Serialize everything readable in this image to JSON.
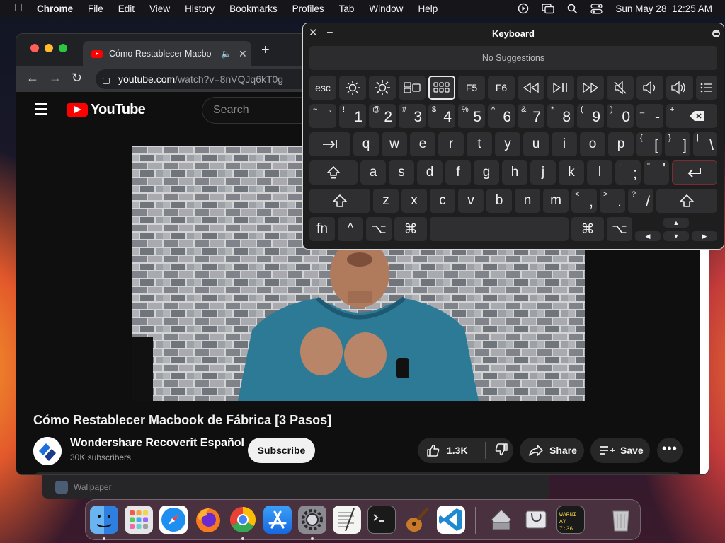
{
  "menubar": {
    "app": "Chrome",
    "items": [
      "File",
      "Edit",
      "View",
      "History",
      "Bookmarks",
      "Profiles",
      "Tab",
      "Window",
      "Help"
    ],
    "datetime": "Sun May 28  12:25 AM"
  },
  "background_window": {
    "label": "Wallpaper"
  },
  "browser": {
    "tab_title": "Cómo Restablecer Macbo",
    "url_domain": "youtube.com",
    "url_path": "/watch?v=8nVQJq6kT0g"
  },
  "youtube": {
    "logo_text": "YouTube",
    "search_placeholder": "Search",
    "video_title": "Cómo Restablecer Macbook de Fábrica [3 Pasos]",
    "channel_name": "Wondershare Recoverit Español",
    "subscribers": "30K subscribers",
    "subscribe_label": "Subscribe",
    "likes": "1.3K",
    "share_label": "Share",
    "save_label": "Save"
  },
  "keyboard_viewer": {
    "title": "Keyboard",
    "suggestions": "No Suggestions",
    "keys": {
      "esc": "esc",
      "f5": "F5",
      "f6": "F6",
      "tilde": "~",
      "backtick": "`",
      "n1": "1",
      "n1s": "!",
      "n2": "2",
      "n2s": "@",
      "n3": "3",
      "n3s": "#",
      "n4": "4",
      "n4s": "$",
      "n5": "5",
      "n5s": "%",
      "n6": "6",
      "n6s": "^",
      "n7": "7",
      "n7s": "&",
      "n8": "8",
      "n8s": "*",
      "n9": "9",
      "n9s": "(",
      "n0": "0",
      "n0s": ")",
      "minus": "-",
      "minus_s": "_",
      "equals": "=",
      "equals_s": "+",
      "q": "q",
      "w": "w",
      "e": "e",
      "r": "r",
      "t": "t",
      "y": "y",
      "u": "u",
      "i": "i",
      "o": "o",
      "p": "p",
      "lbracket": "[",
      "lbracket_s": "{",
      "rbracket": "]",
      "rbracket_s": "}",
      "backslash": "\\",
      "backslash_s": "|",
      "a": "a",
      "s": "s",
      "d": "d",
      "f": "f",
      "g": "g",
      "h": "h",
      "j": "j",
      "k": "k",
      "l": "l",
      "semicolon": ";",
      "semicolon_s": ":",
      "quote": "'",
      "quote_s": "\"",
      "z": "z",
      "x": "x",
      "c": "c",
      "v": "v",
      "b": "b",
      "n": "n",
      "m": "m",
      "comma": ",",
      "comma_s": "<",
      "period": ".",
      "period_s": ">",
      "slash": "/",
      "slash_s": "?",
      "fn": "fn",
      "control": "^",
      "option": "⌥",
      "command": "⌘"
    }
  },
  "dock": {
    "apps": [
      "finder",
      "launchpad",
      "safari",
      "firefox",
      "chrome",
      "app-store",
      "system-settings",
      "textedit",
      "terminal",
      "garageband",
      "vscode",
      "disk-utility",
      "disk-utility-2",
      "console"
    ],
    "console_text": "WARNI AY 7:36"
  }
}
